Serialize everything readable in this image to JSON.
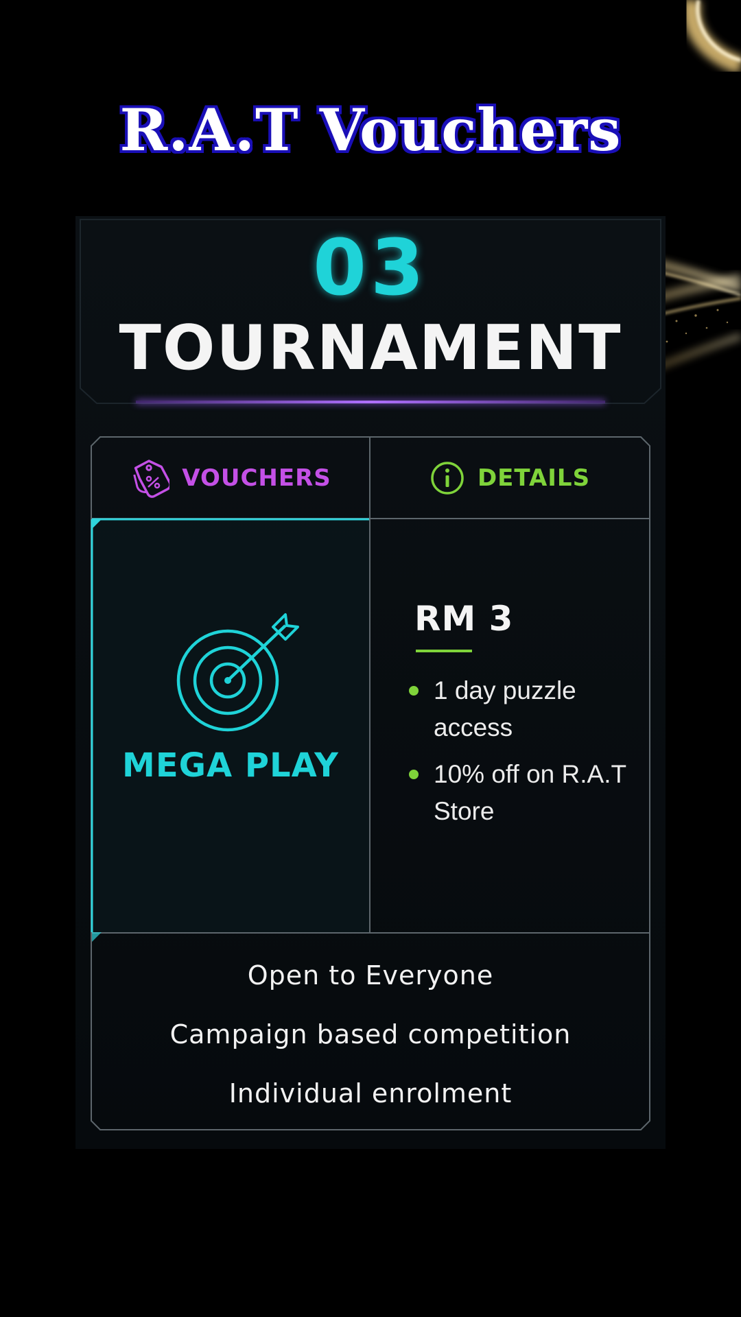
{
  "page": {
    "title": "R.A.T Vouchers"
  },
  "tournament": {
    "number": "03",
    "title": "TOURNAMENT"
  },
  "tabs": {
    "vouchers_label": "VOUCHERS",
    "vouchers_icon": "discount-tag-icon",
    "details_label": "DETAILS",
    "details_icon": "info-icon"
  },
  "voucher": {
    "name": "MEGA PLAY",
    "icon": "target-arrow-icon",
    "price": "RM 3",
    "benefits": [
      "1 day puzzle access",
      "10% off on R.A.T Store"
    ]
  },
  "features": [
    "Open to Everyone",
    "Campaign based competition",
    "Individual enrolment"
  ],
  "colors": {
    "accent_cyan": "#1fd3d8",
    "accent_purple": "#c450e6",
    "accent_green": "#7fd33a",
    "title_outline": "#1a0fb8",
    "background": "#000000"
  }
}
